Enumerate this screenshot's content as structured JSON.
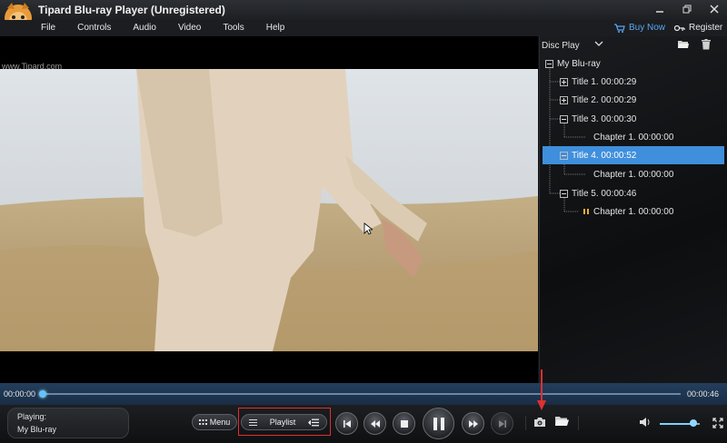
{
  "window": {
    "title": "Tipard Blu-ray Player (Unregistered)",
    "controls": [
      "minimize-icon",
      "restore-icon",
      "close-icon"
    ]
  },
  "menu": {
    "items": [
      "File",
      "Controls",
      "Audio",
      "Video",
      "Tools",
      "Help"
    ],
    "buy_now": "Buy Now",
    "register": "Register"
  },
  "video": {
    "watermark": "www.Tipard.com"
  },
  "playlist_panel": {
    "mode": "Disc Play",
    "tree": [
      {
        "label": "My Blu-ray",
        "level": 0,
        "expander": "minus"
      },
      {
        "label": "Title 1. 00:00:29",
        "level": 1,
        "expander": "plus"
      },
      {
        "label": "Title 2. 00:00:29",
        "level": 1,
        "expander": "plus"
      },
      {
        "label": "Title 3. 00:00:30",
        "level": 1,
        "expander": "minus"
      },
      {
        "label": "Chapter 1. 00:00:00",
        "level": 2,
        "expander": "none"
      },
      {
        "label": "Title 4. 00:00:52",
        "level": 1,
        "expander": "minus",
        "selected": true
      },
      {
        "label": "Chapter 1. 00:00:00",
        "level": 2,
        "expander": "none"
      },
      {
        "label": "Title 5. 00:00:46",
        "level": 1,
        "expander": "minus"
      },
      {
        "label": "Chapter 1. 00:00:00",
        "level": 2,
        "expander": "none",
        "playing": true
      }
    ],
    "selected_color": "#3f8fdc"
  },
  "seek": {
    "current": "00:00:00",
    "total": "00:00:46",
    "progress": 0.0
  },
  "controls": {
    "status_label": "Playing:",
    "status_value": "My Blu-ray",
    "menu_label": "Menu",
    "playlist_label": "Playlist",
    "volume_level": 0.85
  },
  "colors": {
    "accent": "#3f8fdc",
    "buy_now": "#5aa6f0",
    "annotation": "#e03030"
  }
}
